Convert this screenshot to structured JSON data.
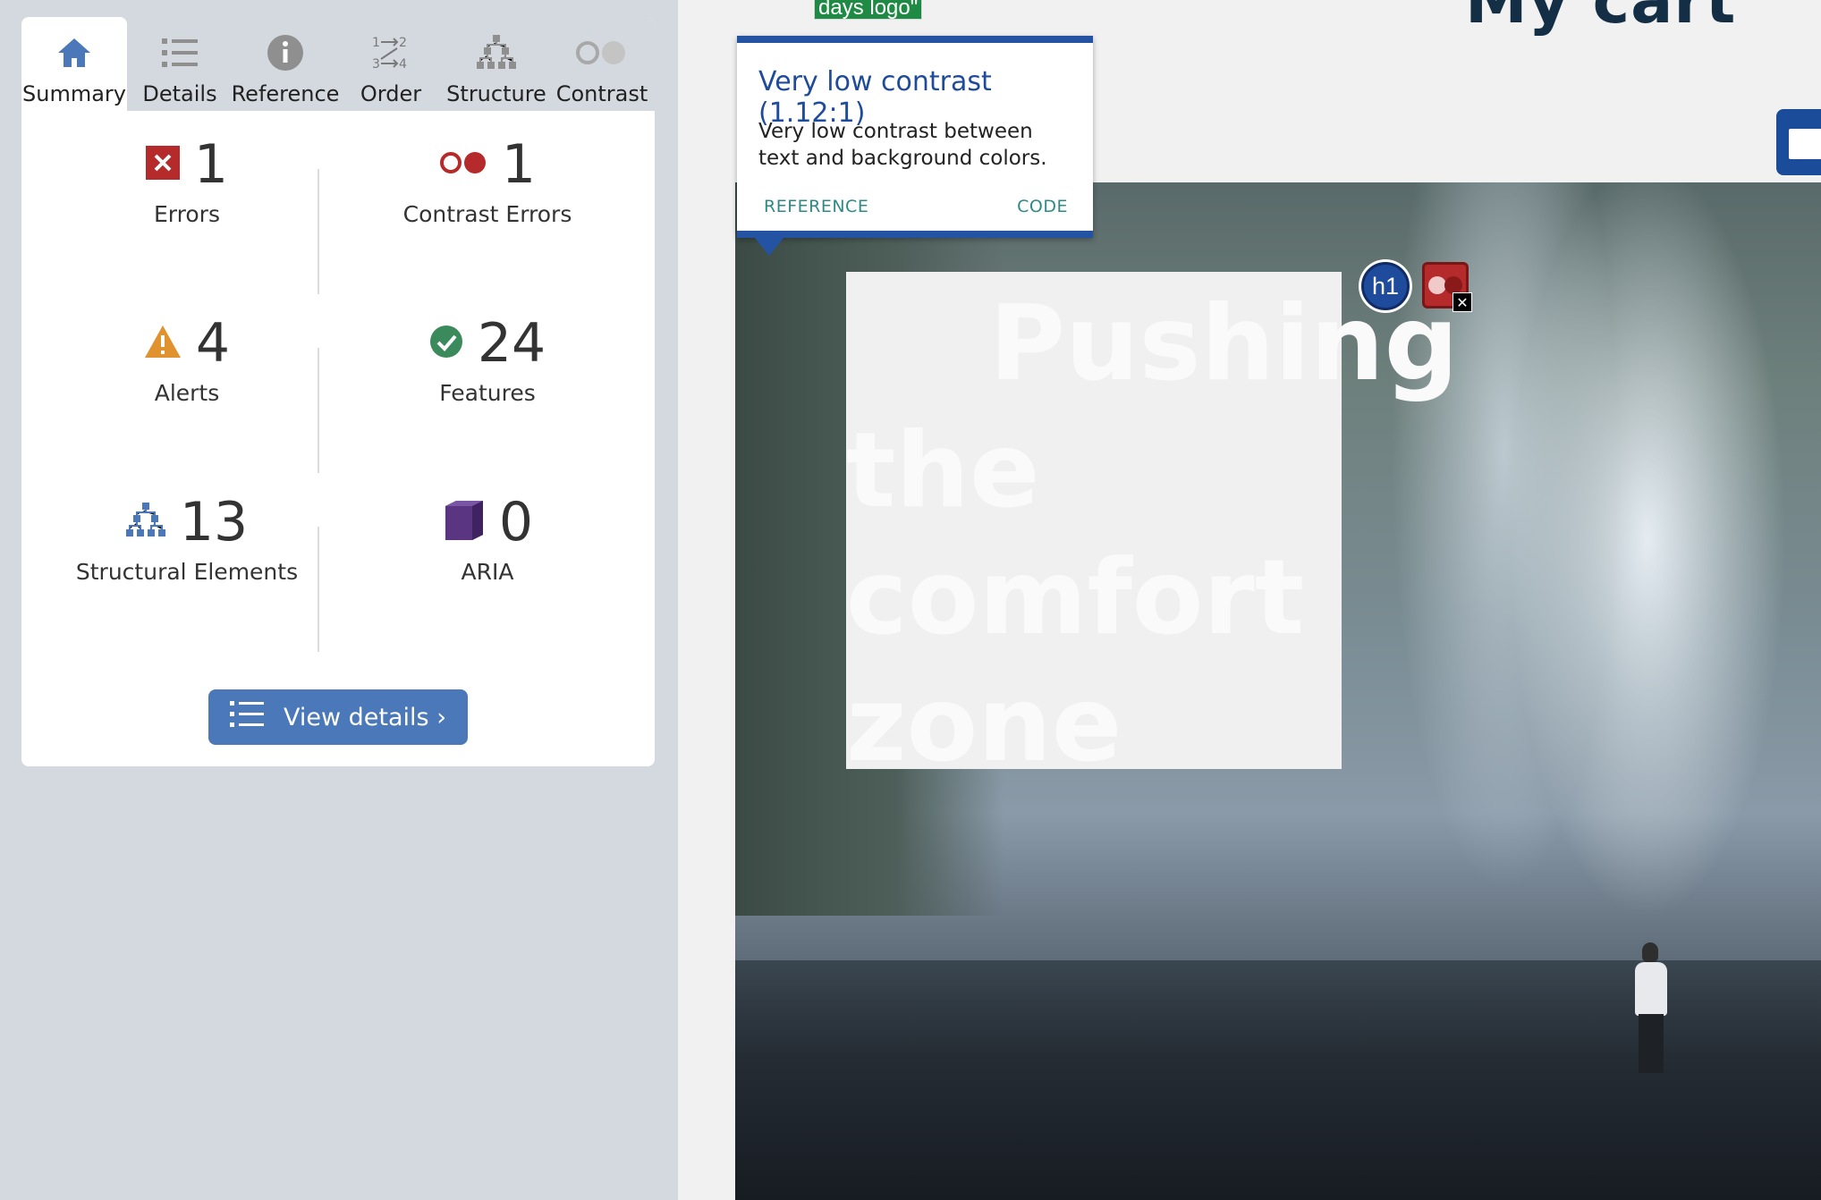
{
  "sidebar": {
    "tabs": [
      {
        "label": "Summary",
        "icon": "home-icon",
        "active": true
      },
      {
        "label": "Details",
        "icon": "list-icon",
        "active": false
      },
      {
        "label": "Reference",
        "icon": "info-icon",
        "active": false
      },
      {
        "label": "Order",
        "icon": "order-icon",
        "active": false
      },
      {
        "label": "Structure",
        "icon": "structure-icon",
        "active": false
      },
      {
        "label": "Contrast",
        "icon": "contrast-icon",
        "active": false
      }
    ],
    "stats": {
      "errors": {
        "value": "1",
        "label": "Errors",
        "icon": "error-icon",
        "color": "#b52a2a"
      },
      "contrast_errors": {
        "value": "1",
        "label": "Contrast Errors",
        "icon": "contrast-error-icon",
        "color": "#b52a2a"
      },
      "alerts": {
        "value": "4",
        "label": "Alerts",
        "icon": "alert-icon",
        "color": "#e0922f"
      },
      "features": {
        "value": "24",
        "label": "Features",
        "icon": "feature-check-icon",
        "color": "#3b8a5c"
      },
      "structural": {
        "value": "13",
        "label": "Structural Elements",
        "icon": "structure-icon",
        "color": "#4a78b9"
      },
      "aria": {
        "value": "0",
        "label": "ARIA",
        "icon": "aria-cube-icon",
        "color": "#5a3582"
      }
    },
    "view_details_label": "View details ›"
  },
  "page": {
    "logo_alt": "days logo\"",
    "cart_title": "My cart",
    "hero_heading": "Pushing the comfort zone",
    "badges": {
      "h1": "h1"
    }
  },
  "tooltip": {
    "title": "Very low contrast (1.12:1)",
    "body": "Very low contrast between text and background colors.",
    "reference_link": "REFERENCE",
    "code_link": "CODE"
  }
}
